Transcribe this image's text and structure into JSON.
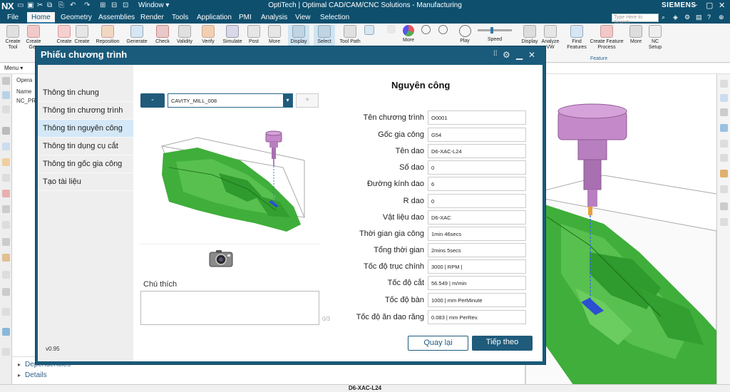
{
  "titlebar": {
    "logo": "NX",
    "window_menu": "Window ▾",
    "title": "OptiTech | Optimal CAD/CAM/CNC Solutions - Manufacturing",
    "brand": "SIEMENS"
  },
  "menubar": {
    "file": "File",
    "tabs": [
      "Home",
      "Geometry",
      "Assemblies",
      "Render",
      "Tools",
      "Application",
      "PMI",
      "Analysis",
      "View",
      "Selection"
    ],
    "search_placeholder": "Type Here to Search"
  },
  "ribbon": {
    "buttons": [
      "Create Tool",
      "Create Geo",
      "Create",
      "Create",
      "Reposition",
      "Generate",
      "Check",
      "Validity",
      "Verify",
      "Simulate",
      "Post",
      "More",
      "Display",
      "Select",
      "Tool Path",
      "",
      "",
      "More",
      "",
      "",
      "Play",
      "Speed",
      "",
      "Display",
      "Analyze VW",
      "Find Features",
      "Create Feature Process",
      "More",
      "NC Setup"
    ],
    "group_feature": "Feature"
  },
  "row2": {
    "menu": "Menu ▾"
  },
  "navigator": {
    "lines": [
      "Opera",
      "Name",
      "NC_PR"
    ],
    "bottom": [
      "Dependencies",
      "Details"
    ]
  },
  "status": {
    "text": "D6-XAC-L24"
  },
  "dialog": {
    "title": "Phiếu chương trình",
    "nav": [
      "Thông tin chung",
      "Thông tin chương trình",
      "Thông tin nguyên công",
      "Thông tin dụng cụ cắt",
      "Thông tin gốc gia công",
      "Tạo tài liệu"
    ],
    "active_nav": 2,
    "version": "v0.95",
    "dash_button": "-",
    "operation_select": "CAVITY_MILL_008",
    "side_button": "+",
    "note_label": "Chú thích",
    "note_count": "0/3",
    "section_title": "Nguyên công",
    "fields": [
      {
        "label": "Tên chương trình",
        "value": "O0001"
      },
      {
        "label": "Gốc gia công",
        "value": "G54"
      },
      {
        "label": "Tên dao",
        "value": "D6-XAC-L24"
      },
      {
        "label": "Số dao",
        "value": "0"
      },
      {
        "label": "Đường kính dao",
        "value": "6"
      },
      {
        "label": "R dao",
        "value": "0"
      },
      {
        "label": "Vật liệu dao",
        "value": "D6-XAC"
      },
      {
        "label": "Thời gian gia công",
        "value": "1min 46secs"
      },
      {
        "label": "Tổng thời gian",
        "value": "2mins 5secs"
      },
      {
        "label": "Tốc độ trục chính",
        "value": "3000 | RPM |"
      },
      {
        "label": "Tốc độ cắt",
        "value": "56.549 | m/min"
      },
      {
        "label": "Tốc độ bàn",
        "value": "1000 | mm PerMinute"
      },
      {
        "label": "Tốc độ ăn dao răng",
        "value": "0.083 | mm PerRev."
      }
    ],
    "back_button": "Quay lại",
    "next_button": "Tiếp theo"
  },
  "colors": {
    "header_blue": "#0e4f6e",
    "dialog_blue": "#1a5a7a",
    "active_nav_bg": "#d4e8f7",
    "part_green": "#3fae3a",
    "tool_purple": "#b77fc0"
  }
}
